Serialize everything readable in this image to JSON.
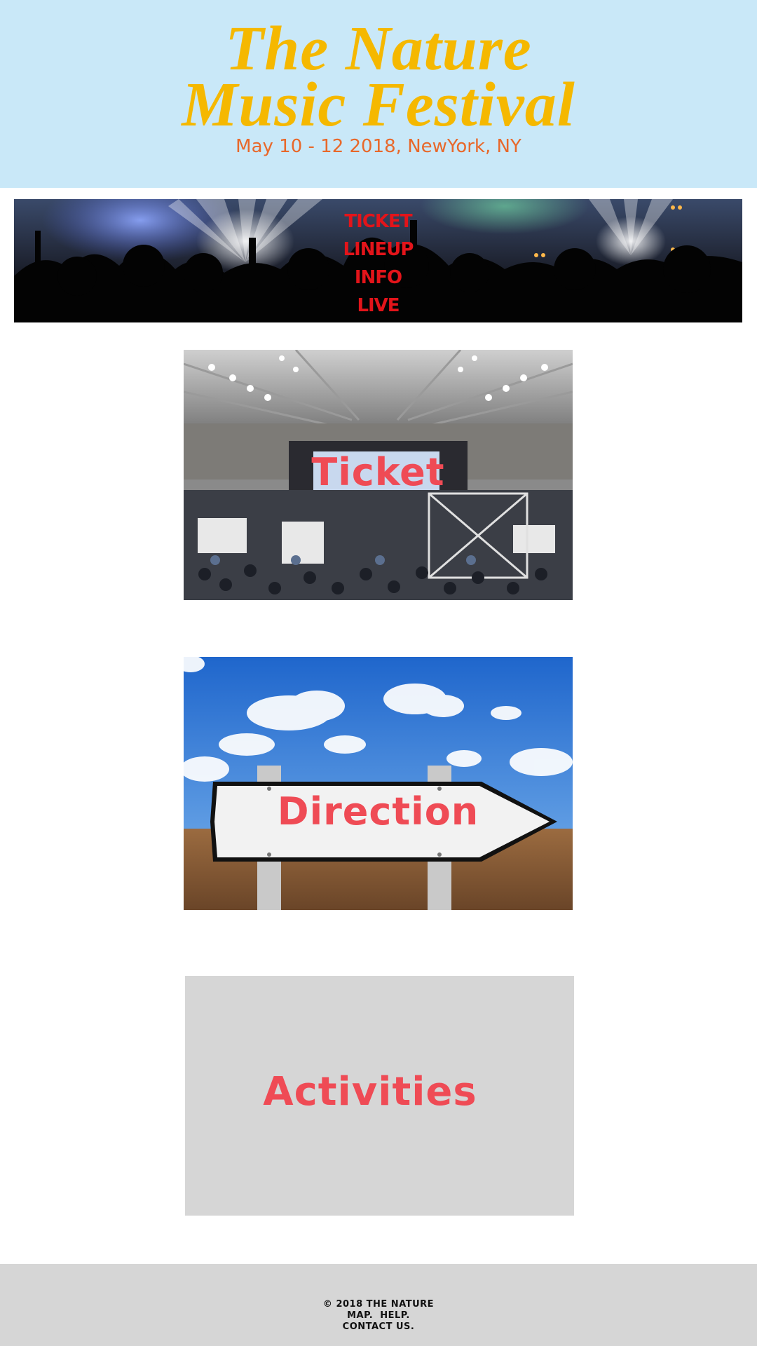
{
  "header": {
    "title_line1": "The Nature",
    "title_line2": "Music Festival",
    "dates": "May 10 - 12 2018, NewYork, NY"
  },
  "nav": {
    "links": [
      "TICKET",
      "LINEUP",
      "INFO",
      "LIVE"
    ]
  },
  "cards": {
    "ticket": "Ticket",
    "direction": "Direction",
    "activities": "Activities"
  },
  "footer": {
    "copyright": "© 2018 THE NATURE",
    "links_line": "MAP.  HELP.",
    "contact": "CONTACT US."
  },
  "colors": {
    "header_bg": "#c9e8f8",
    "title": "#f5b800",
    "dates": "#e8682a",
    "nav_link": "#e3141a",
    "card_label": "#ef4b55",
    "footer_bg": "#d6d6d6"
  }
}
